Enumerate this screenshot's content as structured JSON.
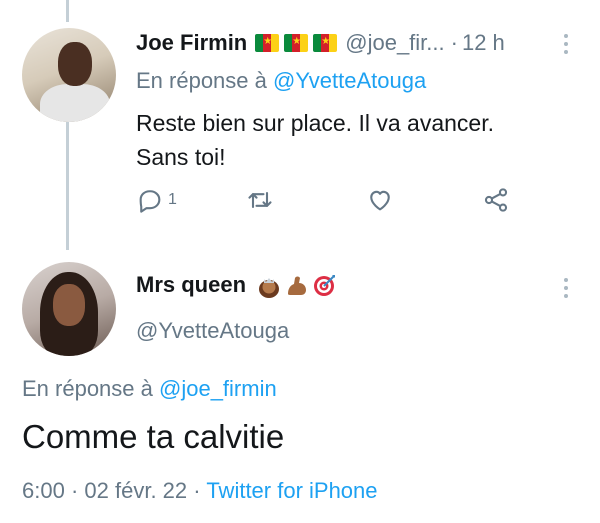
{
  "tweet1": {
    "display_name": "Joe Firmin",
    "handle": "@joe_fir...",
    "separator": "·",
    "time": "12 h",
    "reply_prefix": "En réponse à",
    "reply_to": "@YvetteAtouga",
    "text_line1": "Reste bien sur place. Il va avancer.",
    "text_line2": "Sans toi!",
    "reply_count": "1",
    "icons": [
      "reply-icon",
      "retweet-icon",
      "like-icon",
      "share-icon"
    ],
    "flag_count": 3
  },
  "tweet2": {
    "display_name": "Mrs queen",
    "handle": "@YvetteAtouga",
    "reply_prefix": "En réponse à",
    "reply_to": "@joe_firmin",
    "text": "Comme ta calvitie",
    "time": "6:00",
    "meta_sep": "·",
    "date": "02 févr. 22",
    "source": "Twitter for iPhone",
    "emoji_names": [
      "woman-with-crown-emoji",
      "flexed-biceps-emoji",
      "direct-hit-emoji"
    ]
  },
  "colors": {
    "link": "#1da1f2",
    "secondary": "#657786",
    "thread_line": "#c4cfd6"
  }
}
